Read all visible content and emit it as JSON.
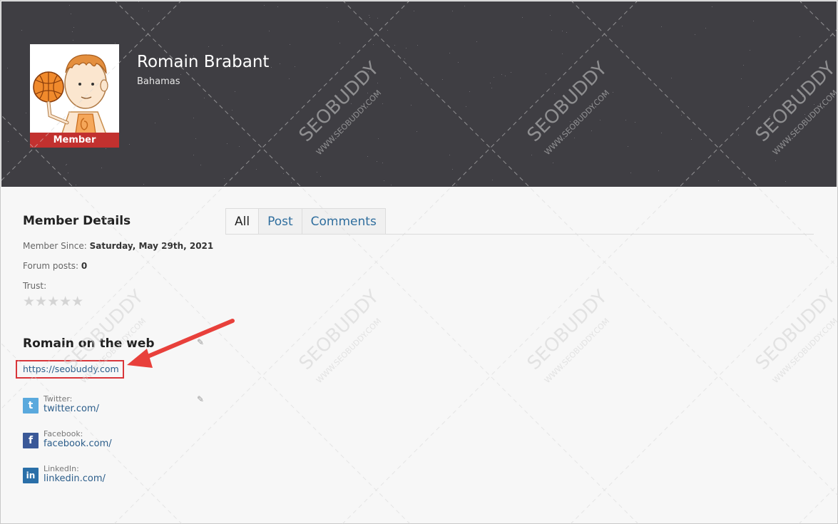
{
  "profile": {
    "name": "Romain Brabant",
    "location": "Bahamas",
    "badge": "Member",
    "avatar_icon": "cartoon-basketball-avatar"
  },
  "member_details": {
    "title": "Member Details",
    "since_label": "Member Since:",
    "since_value": "Saturday, May 29th, 2021",
    "posts_label": "Forum posts:",
    "posts_value": "0",
    "trust_label": "Trust:",
    "trust_stars": "★★★★★",
    "trust_rating": 0
  },
  "web": {
    "title": "Romain on the web",
    "website": "https://seobuddy.com",
    "social": [
      {
        "label": "Twitter:",
        "url": "twitter.com/",
        "icon": "twitter-icon",
        "icon_glyph": "t",
        "color": "#5aa9dd"
      },
      {
        "label": "Facebook:",
        "url": "facebook.com/",
        "icon": "facebook-icon",
        "icon_glyph": "f",
        "color": "#3b5998"
      },
      {
        "label": "LinkedIn:",
        "url": "linkedin.com/",
        "icon": "linkedin-icon",
        "icon_glyph": "in",
        "color": "#2a6fa8"
      }
    ]
  },
  "tabs": [
    {
      "label": "All",
      "active": true
    },
    {
      "label": "Post",
      "active": false
    },
    {
      "label": "Comments",
      "active": false
    }
  ],
  "watermark": {
    "text": "SEOBUDDY",
    "subtext": "WWW.SEOBUDDY.COM"
  },
  "colors": {
    "hero_bg": "#3f3e43",
    "badge": "#c2312f",
    "link": "#2b5d8a",
    "annotation": "#e8403b"
  }
}
